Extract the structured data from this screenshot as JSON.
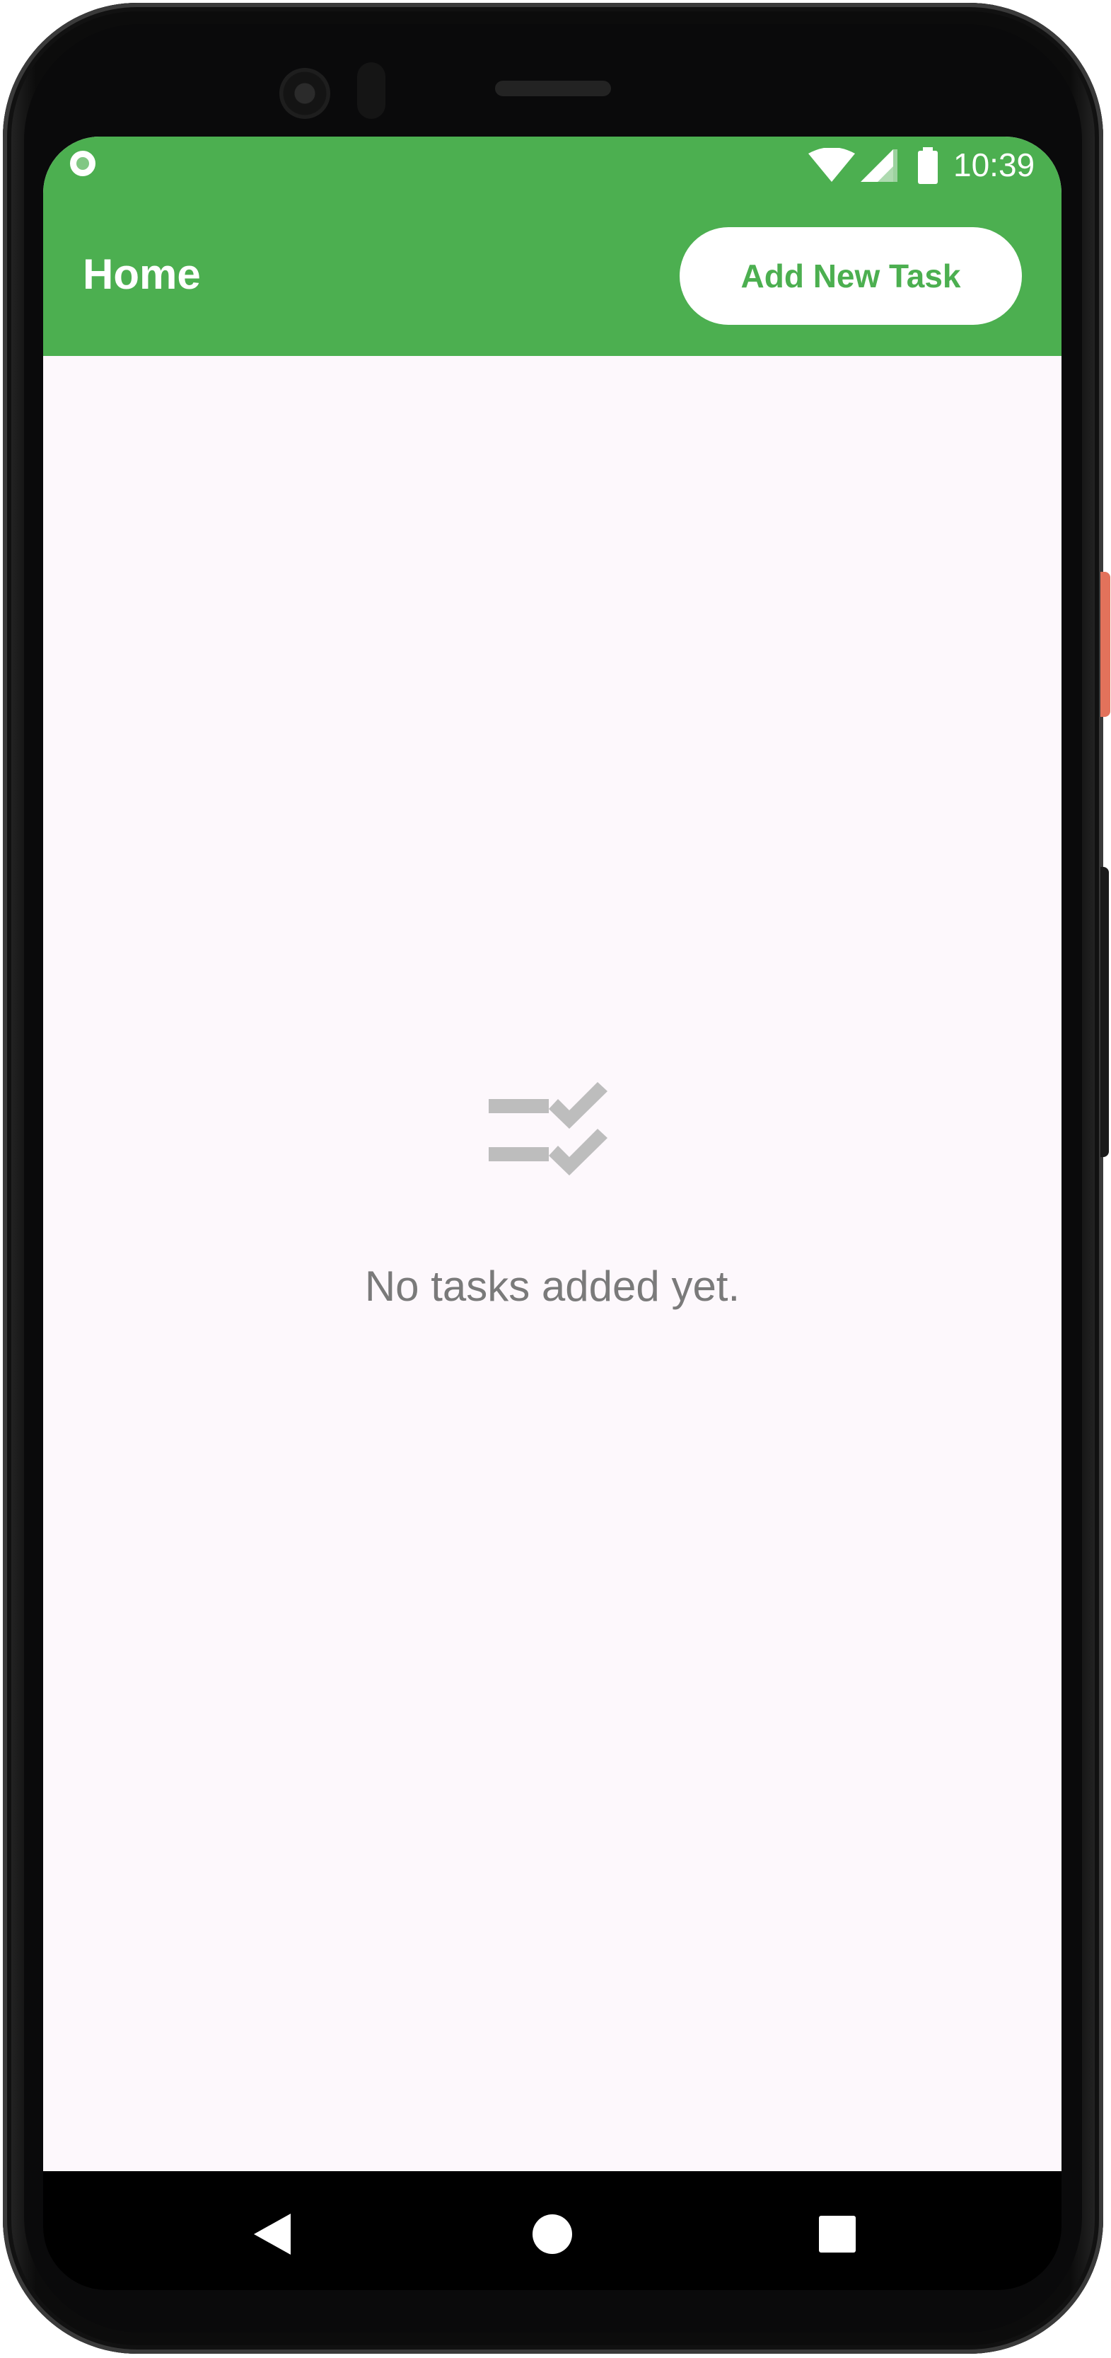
{
  "status_bar": {
    "time": "10:39",
    "icons": [
      "app-notification-icon",
      "wifi-icon",
      "cellular-signal-icon",
      "battery-icon"
    ]
  },
  "app_bar": {
    "title": "Home",
    "add_button_label": "Add New Task",
    "color": "#4caf50"
  },
  "empty_state": {
    "icon": "checklist-icon",
    "message": "No tasks added yet."
  },
  "nav_bar": {
    "buttons": [
      "back-icon",
      "home-icon",
      "recents-icon"
    ]
  },
  "colors": {
    "accent": "#4caf50",
    "background": "#fdf8fc",
    "muted_text": "#7a7a7a"
  }
}
